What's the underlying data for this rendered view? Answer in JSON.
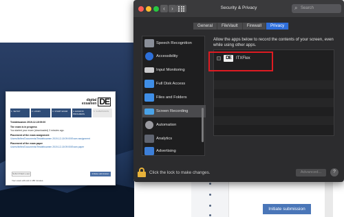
{
  "window": {
    "title": "Security & Privacy",
    "search_placeholder": "Search",
    "tabs": [
      {
        "label": "General"
      },
      {
        "label": "FileVault"
      },
      {
        "label": "Firewall"
      },
      {
        "label": "Privacy",
        "active": true
      }
    ]
  },
  "sidebar": {
    "items": [
      {
        "label": "Speech Recognition",
        "icon": "speech-recognition-icon"
      },
      {
        "label": "Accessibility",
        "icon": "accessibility-icon"
      },
      {
        "label": "Input Monitoring",
        "icon": "keyboard-icon"
      },
      {
        "label": "Full Disk Access",
        "icon": "folder-icon"
      },
      {
        "label": "Files and Folders",
        "icon": "folder-icon"
      },
      {
        "label": "Screen Recording",
        "icon": "display-icon",
        "selected": true
      },
      {
        "label": "Automation",
        "icon": "gear-icon"
      },
      {
        "label": "Analytics",
        "icon": "analytics-icon"
      },
      {
        "label": "Advertising",
        "icon": "megaphone-icon"
      }
    ]
  },
  "main": {
    "description": "Allow the apps below to record the contents of your screen, even while using other apps.",
    "apps": [
      {
        "name": "ITXFlex",
        "checked": false,
        "icon_text": "DE"
      }
    ]
  },
  "footer": {
    "lock_text": "Click the lock to make changes.",
    "advanced_label": "Advanced...",
    "help_label": "?"
  },
  "exam_window": {
    "logo_line1": "digital",
    "logo_line2": "exsamen",
    "logo_mark": "DE",
    "steps": [
      "1. SETUP",
      "2. LOGIN",
      "3. START EXAM",
      "4. EXAM IN PROGRESS",
      "5. SUBMISSION"
    ],
    "session": "Testdeksamen 2019-12-18 09:00",
    "status_heading": "The exam is in progress",
    "status_text": "You started your exam (downloaded) 3 minutes ago.",
    "assignment_heading": "Placement of the exam assignment",
    "assignment_path": "/Users/itxflex/Documents/Testdeksamen 2019-12-18 09:00/Exam assignment",
    "paper_heading": "Placement of the exam paper",
    "paper_path": "/Users/itxflex/Documents/Testdeksamen 2019-12-18 09:00/Exam paper",
    "submit_blank_label": "Submit blank exam",
    "initiate_label": "Initiate submission",
    "footer_text": "Your exam will end in 185 minutes."
  },
  "background_app": {
    "initiate_label": "Initiate submission"
  },
  "colors": {
    "accent": "#2f6fdb",
    "highlight": "#e01b22",
    "lock": "#e8b23a"
  }
}
